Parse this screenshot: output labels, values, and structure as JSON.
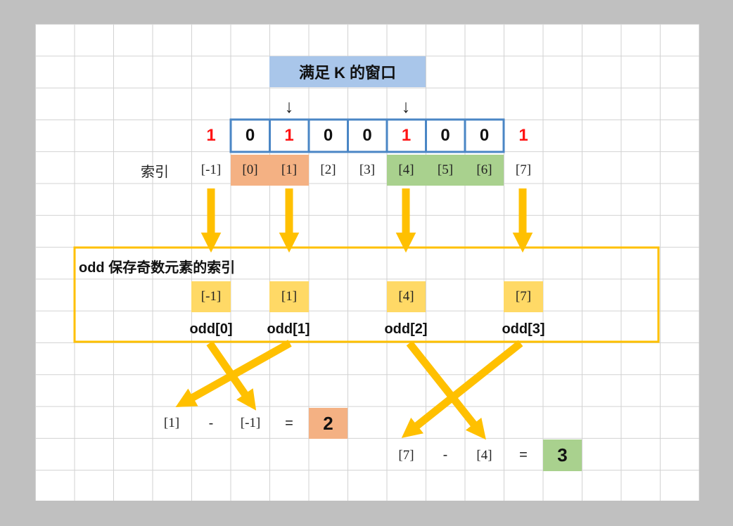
{
  "title": "满足 K 的窗口",
  "down_arrow_glyph": "↓",
  "bits": [
    "1",
    "0",
    "1",
    "0",
    "0",
    "1",
    "0",
    "0",
    "1"
  ],
  "index_label": "索引",
  "indices": [
    "[-1]",
    "[0]",
    "[1]",
    "[2]",
    "[3]",
    "[4]",
    "[5]",
    "[6]",
    "[7]"
  ],
  "odd_box": {
    "label": "odd 保存奇数元素的索引",
    "values": [
      "[-1]",
      "[1]",
      "[4]",
      "[7]"
    ],
    "names": [
      "odd[0]",
      "odd[1]",
      "odd[2]",
      "odd[3]"
    ]
  },
  "calc1": {
    "a": "[1]",
    "op": "-",
    "b": "[-1]",
    "eq": "=",
    "result": "2"
  },
  "calc2": {
    "a": "[7]",
    "op": "-",
    "b": "[4]",
    "eq": "=",
    "result": "3"
  },
  "colors": {
    "odd_bit": "#ff1414",
    "window_border": "#4a86c5",
    "title_bg": "#a9c6ea",
    "orange_highlight": "#f4b183",
    "green_highlight": "#a9d18e",
    "yellow_highlight": "#ffd966",
    "arrow": "#ffc000",
    "box_border": "#ffc000"
  }
}
